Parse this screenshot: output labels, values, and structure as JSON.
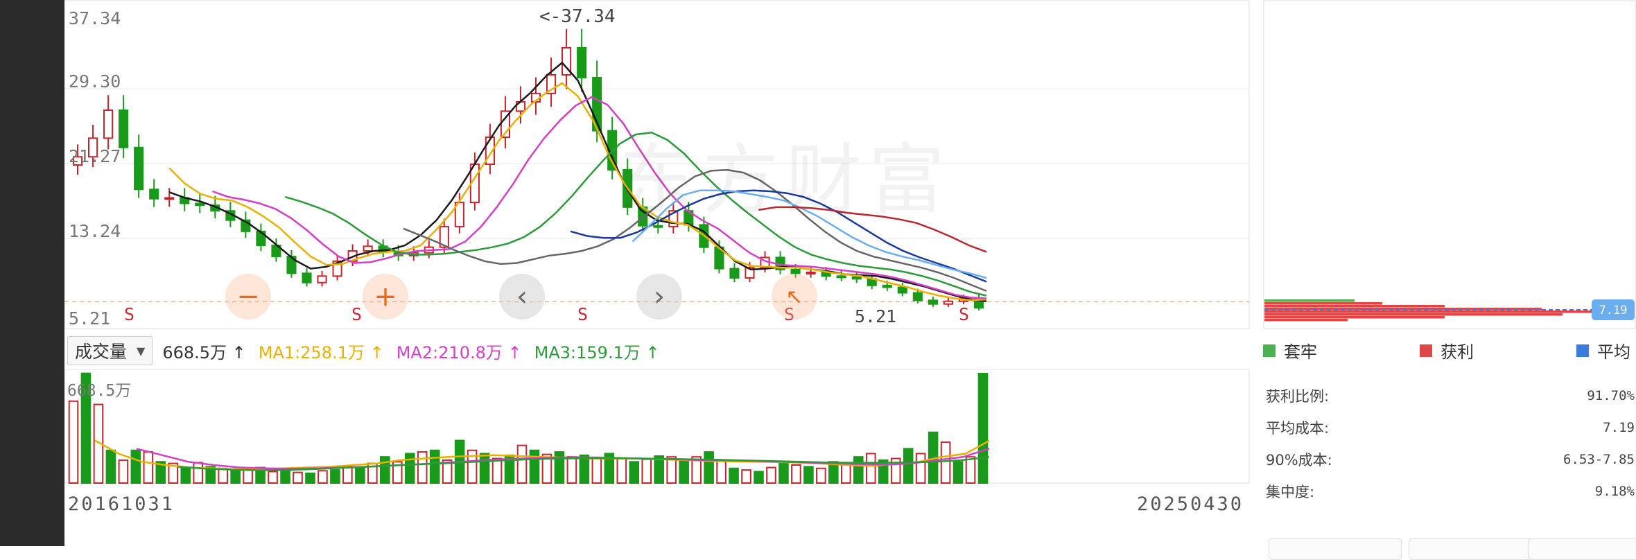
{
  "chart_data": [
    {
      "type": "candlestick",
      "title": "",
      "ylim": [
        5.21,
        37.34
      ],
      "y_ticks": [
        "37.34",
        "29.30",
        "21.27",
        "13.24",
        "5.21"
      ],
      "dates": {
        "start": "20161031",
        "end": "20250430"
      },
      "annotations": {
        "max_label": "<-37.34",
        "min_label": "5.21",
        "s_marker": "S",
        "s_markers_count": 5
      },
      "reference_line": 7.19,
      "closes": [
        22,
        24,
        27,
        23,
        18.5,
        17.5,
        17.6,
        17.0,
        16.8,
        16.2,
        15.2,
        14.0,
        12.5,
        11.3,
        9.5,
        8.5,
        9.2,
        10.8,
        11.9,
        12.4,
        11.8,
        11.4,
        11.7,
        12.3,
        14.5,
        17.1,
        21.2,
        24.1,
        26.9,
        27.9,
        28.8,
        30.8,
        33.7,
        30.5,
        24.8,
        20.6,
        16.6,
        14.6,
        14.5,
        16.2,
        14.7,
        12.3,
        10.0,
        9.0,
        10.1,
        11.2,
        9.9,
        9.5,
        9.6,
        9.2,
        9.1,
        8.9,
        8.2,
        8.0,
        7.4,
        6.6,
        6.2,
        6.5,
        6.8,
        5.8
      ],
      "ma_lines": [
        {
          "color": "#1a1a1a",
          "values": [
            18.2,
            17.6,
            17.2,
            16.6,
            15.8,
            14.9,
            13.7,
            12.3,
            10.9,
            10.0,
            10.2,
            10.8,
            11.5,
            11.9,
            12.0,
            12.5,
            13.6,
            15.2,
            17.4,
            20.0,
            22.8,
            25.4,
            27.4,
            28.9,
            30.7,
            32.1,
            30.2,
            26.5,
            22.6,
            18.9,
            16.3,
            15.2,
            14.9,
            14.8,
            14.0,
            12.4,
            10.8,
            9.9,
            10.0,
            10.2,
            10.1,
            9.9,
            9.7,
            9.4,
            9.3,
            9.2,
            8.9,
            8.5,
            8.1,
            7.6,
            7.1,
            6.7,
            6.5
          ]
        },
        {
          "color": "#e8b000",
          "values": [
            20.8,
            19.1,
            18.0,
            17.5,
            17.3,
            16.6,
            15.6,
            14.4,
            12.8,
            11.3,
            10.4,
            10.5,
            11.1,
            11.6,
            11.8,
            11.9,
            12.5,
            14.2,
            16.1,
            18.6,
            21.2,
            23.8,
            25.8,
            27.6,
            28.9,
            29.9,
            28.5,
            25.8,
            22.0,
            19.0,
            16.7,
            15.6,
            15.0,
            14.7,
            13.6,
            12.2,
            10.9,
            10.3,
            10.2,
            10.1,
            10.1,
            9.9,
            9.6,
            9.4,
            9.2,
            8.8,
            8.4,
            8.0,
            7.5,
            7.1,
            6.8,
            6.6,
            6.7
          ]
        },
        {
          "color": "#d33fc6",
          "values": [
            18.3,
            17.7,
            17.4,
            17.0,
            16.4,
            15.4,
            14.1,
            12.6,
            11.3,
            10.6,
            10.7,
            11.1,
            11.6,
            11.9,
            12.0,
            12.1,
            12.9,
            14.5,
            16.6,
            19.0,
            21.7,
            24.0,
            25.9,
            27.5,
            28.4,
            27.6,
            25.6,
            22.9,
            20.3,
            18.0,
            16.3,
            15.2,
            14.3,
            13.0,
            11.7,
            10.8,
            10.4,
            10.3,
            10.2,
            10.0,
            9.8,
            9.6,
            9.4,
            9.1,
            8.7,
            8.2,
            7.7,
            7.2,
            6.9,
            6.8
          ]
        },
        {
          "color": "#2d9a3a",
          "values": [
            17.7,
            17.2,
            16.6,
            15.9,
            14.9,
            13.7,
            12.6,
            11.8,
            11.5,
            11.5,
            11.6,
            11.8,
            12.0,
            12.3,
            12.7,
            13.4,
            14.5,
            16.0,
            17.8,
            19.8,
            21.7,
            23.4,
            24.4,
            24.6,
            23.8,
            22.4,
            20.6,
            18.9,
            17.4,
            16.0,
            14.7,
            13.4,
            12.3,
            11.5,
            11.0,
            10.6,
            10.3,
            10.1,
            9.9,
            9.6,
            9.2,
            8.7,
            8.1,
            7.5,
            7.1
          ]
        },
        {
          "color": "#666666",
          "values": [
            14.3,
            13.6,
            12.9,
            12.1,
            11.4,
            10.8,
            10.5,
            10.6,
            11.0,
            11.4,
            11.6,
            11.9,
            12.4,
            13.2,
            14.4,
            15.8,
            17.2,
            18.7,
            19.9,
            20.5,
            20.6,
            20.3,
            19.5,
            18.3,
            16.9,
            15.4,
            14.0,
            12.8,
            11.9,
            11.3,
            10.9,
            10.5,
            10.1,
            9.6,
            9.0,
            8.3,
            7.6
          ]
        },
        {
          "color": "#1a3a9a",
          "values": [
            14.0,
            13.5,
            13.3,
            13.3,
            13.9,
            14.8,
            15.8,
            16.7,
            17.5,
            18.0,
            18.3,
            18.4,
            18.3,
            18.1,
            17.7,
            17.0,
            16.1,
            15.0,
            13.9,
            12.8,
            11.9,
            11.2,
            10.6,
            10.0,
            9.3,
            8.6
          ]
        },
        {
          "color": "#6aaef0",
          "values": [
            12.9,
            14.6,
            16.4,
            17.9,
            18.4,
            18.4,
            18.3,
            18.0,
            17.7,
            17.3,
            16.5,
            15.6,
            14.5,
            13.4,
            12.5,
            11.8,
            11.3,
            10.9,
            10.4,
            9.9,
            9.5,
            9.0
          ]
        },
        {
          "color": "#b8282f",
          "values": [
            16.3,
            16.6,
            16.6,
            16.5,
            16.3,
            16.0,
            15.8,
            15.6,
            15.3,
            14.9,
            14.2,
            13.4,
            12.5,
            11.8
          ]
        }
      ]
    },
    {
      "type": "bar",
      "title": "",
      "y_max_label": "668.5万",
      "ylim": [
        0,
        668.5
      ],
      "values": [
        500,
        670,
        480,
        200,
        140,
        200,
        190,
        130,
        120,
        95,
        125,
        100,
        90,
        78,
        85,
        95,
        70,
        80,
        65,
        60,
        75,
        80,
        100,
        95,
        120,
        160,
        130,
        180,
        190,
        200,
        140,
        260,
        200,
        180,
        150,
        170,
        230,
        200,
        175,
        190,
        160,
        170,
        150,
        180,
        150,
        130,
        145,
        165,
        160,
        140,
        160,
        190,
        140,
        90,
        80,
        70,
        95,
        120,
        110,
        100,
        90,
        130,
        120,
        160,
        180,
        140,
        150,
        210,
        180,
        310,
        250,
        130,
        160,
        668.5
      ],
      "ma_lines": [
        {
          "color": "#e8b000",
          "values": [
            260,
            180,
            130,
            110,
            95,
            90,
            85,
            85,
            90,
            95,
            100,
            110,
            120,
            140,
            150,
            160,
            165,
            170,
            165,
            160,
            155,
            150,
            150,
            150,
            145,
            140,
            135,
            132,
            130,
            128,
            125,
            118,
            110,
            105,
            115,
            130,
            160,
            180,
            258.1
          ]
        },
        {
          "color": "#d33fc6",
          "values": [
            210,
            170,
            130,
            110,
            95,
            90,
            88,
            90,
            95,
            100,
            108,
            115,
            125,
            135,
            145,
            150,
            155,
            158,
            156,
            152,
            148,
            144,
            140,
            138,
            135,
            130,
            125,
            120,
            115,
            112,
            120,
            140,
            160,
            210.8
          ]
        },
        {
          "color": "#2d9a3a",
          "values": [
            100,
            88,
            82,
            78,
            80,
            85,
            92,
            100,
            108,
            115,
            122,
            130,
            138,
            145,
            150,
            152,
            152,
            150,
            148,
            145,
            142,
            138,
            134,
            130,
            126,
            124,
            124,
            126,
            130,
            140,
            159.1
          ]
        }
      ]
    }
  ],
  "volume_header": {
    "selector": "成交量",
    "total": "668.5万 ↑",
    "ma1": "MA1:258.1万 ↑",
    "ma2": "MA2:210.8万 ↑",
    "ma3": "MA3:159.1万 ↑"
  },
  "controls": {
    "zoom_out": "−",
    "zoom_in": "+",
    "prev": "‹",
    "next": "›"
  },
  "watermark": "东方财富",
  "distribution": {
    "price_tag": "7.19",
    "legend": {
      "trapped": "套牢",
      "profit": "获利",
      "average": "平均"
    },
    "colors": {
      "trapped": "#4caf50",
      "profit": "#e04646",
      "average": "#3b7ddd"
    },
    "stats": [
      {
        "label": "获利比例:",
        "value": "91.70%"
      },
      {
        "label": "平均成本:",
        "value": "7.19"
      },
      {
        "label": "90%成本:",
        "value": "6.53-7.85"
      },
      {
        "label": "集中度:",
        "value": "9.18%"
      }
    ]
  },
  "colors": {
    "up": "#c8242b",
    "down": "#1a9a1a",
    "grid": "#e8e8e8",
    "ref_line": "#e8b48a"
  }
}
